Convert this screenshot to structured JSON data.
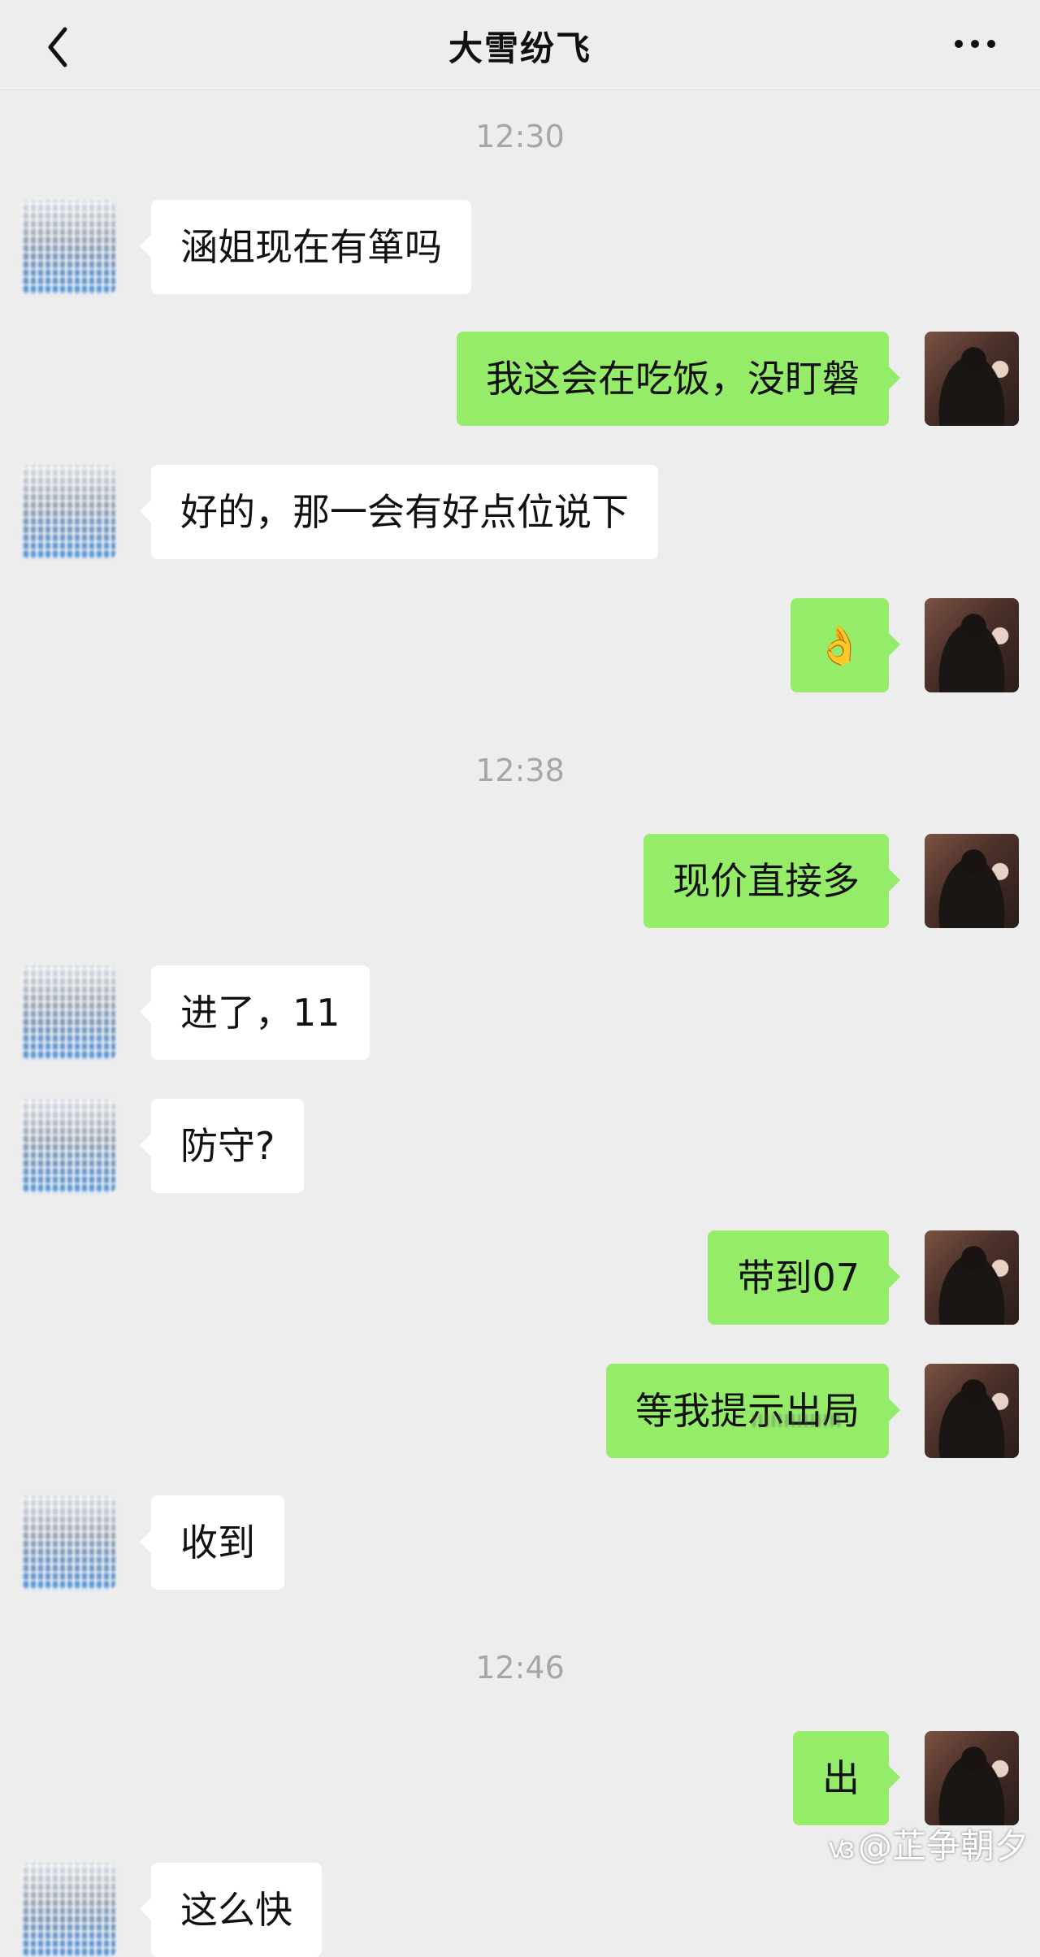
{
  "header": {
    "back_icon": "chevron-left-icon",
    "title": "大雪纷飞",
    "more_icon": "more-dots-icon"
  },
  "timestamps": [
    "12:30",
    "12:38",
    "12:46"
  ],
  "messages": [
    {
      "side": "left",
      "text": "涵姐现在有箪吗"
    },
    {
      "side": "right",
      "text": "我这会在吃饭，没盯磐"
    },
    {
      "side": "left",
      "text": "好的，那一会有好点位说下"
    },
    {
      "side": "right",
      "text": "👌"
    },
    {
      "side": "right",
      "text": "现价直接多"
    },
    {
      "side": "left",
      "text": "进了，11"
    },
    {
      "side": "left",
      "text": "防守?"
    },
    {
      "side": "right",
      "text": "带到07"
    },
    {
      "side": "right",
      "text": "等我提示出局"
    },
    {
      "side": "left",
      "text": "收到"
    },
    {
      "side": "right",
      "text": "出"
    },
    {
      "side": "left",
      "text": "这么快"
    }
  ],
  "watermark": {
    "logo_icon": "platform-logo-icon",
    "text": "@芷争朝夕"
  },
  "colors": {
    "background": "#ededed",
    "my_bubble": "#95ec69",
    "their_bubble": "#ffffff",
    "timestamp_text": "#a6a6a6"
  }
}
